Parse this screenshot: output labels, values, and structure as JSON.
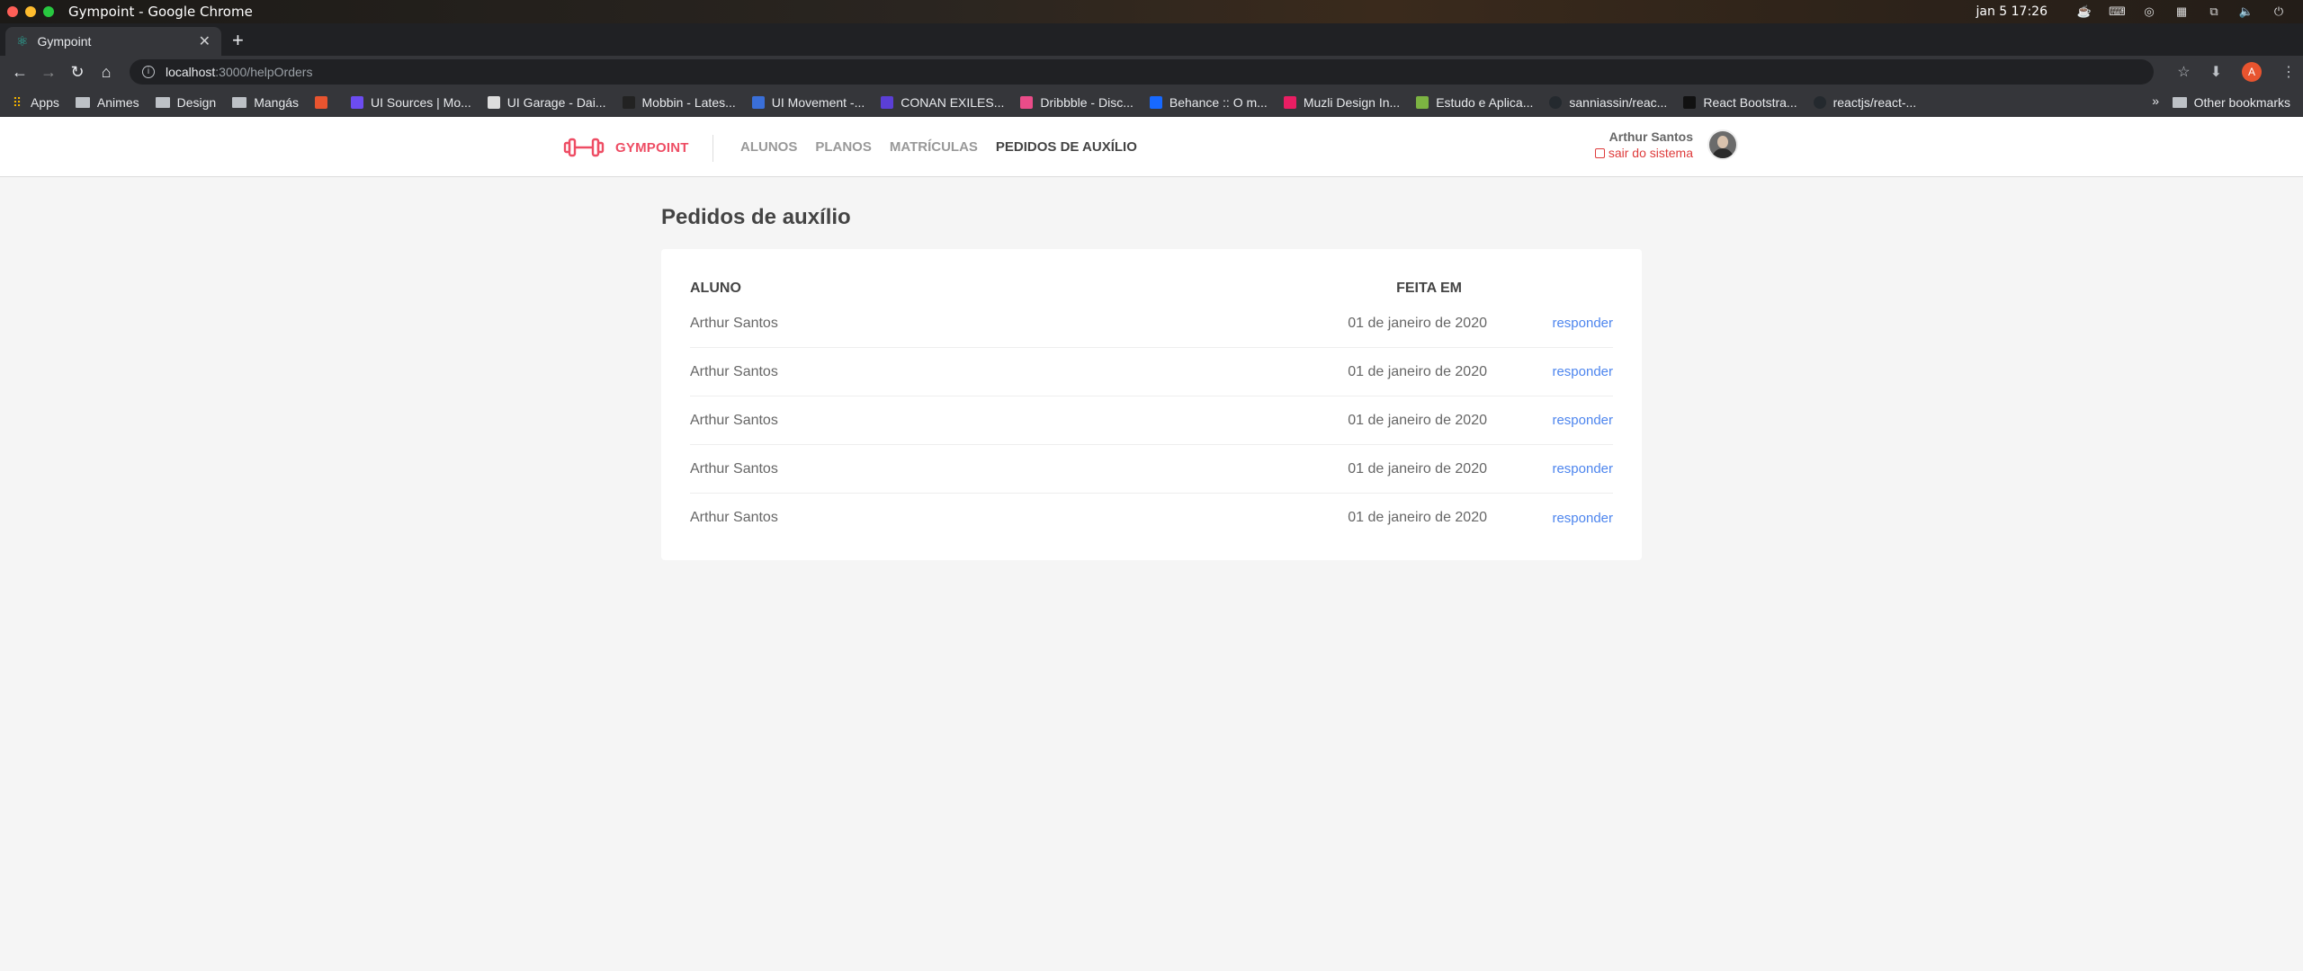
{
  "os": {
    "window_title": "Gympoint - Google Chrome",
    "clock": "jan 5  17:26"
  },
  "browser": {
    "tab_title": "Gympoint",
    "url_host": "localhost",
    "url_path": ":3000/helpOrders",
    "profile_initial": "A",
    "bookmarks": [
      {
        "label": "Apps",
        "icon": "apps-grid-icon",
        "color": "#f4b400"
      },
      {
        "label": "Animes",
        "icon": "folder-icon",
        "color": "#bdc1c6"
      },
      {
        "label": "Design",
        "icon": "folder-icon",
        "color": "#bdc1c6"
      },
      {
        "label": "Mangás",
        "icon": "folder-icon",
        "color": "#bdc1c6"
      },
      {
        "label": "",
        "icon": "site-icon",
        "color": "#e8542f"
      },
      {
        "label": "UI Sources | Mo...",
        "icon": "site-icon",
        "color": "#6c4cf1"
      },
      {
        "label": "UI Garage - Dai...",
        "icon": "site-icon",
        "color": "#dddddd"
      },
      {
        "label": "Mobbin - Lates...",
        "icon": "site-icon",
        "color": "#222222"
      },
      {
        "label": "UI Movement -...",
        "icon": "site-icon",
        "color": "#3a6fd8"
      },
      {
        "label": "CONAN EXILES...",
        "icon": "site-icon",
        "color": "#5b3fd6"
      },
      {
        "label": "Dribbble - Disc...",
        "icon": "site-icon",
        "color": "#ea4c89"
      },
      {
        "label": "Behance :: O m...",
        "icon": "site-icon",
        "color": "#1769ff"
      },
      {
        "label": "Muzli Design In...",
        "icon": "site-icon",
        "color": "#e91e63"
      },
      {
        "label": "Estudo e Aplica...",
        "icon": "site-icon",
        "color": "#7cb342"
      },
      {
        "label": "sanniassin/reac...",
        "icon": "github-icon",
        "color": "#24292e"
      },
      {
        "label": "React Bootstra...",
        "icon": "site-icon",
        "color": "#111111"
      },
      {
        "label": "reactjs/react-...",
        "icon": "github-icon",
        "color": "#24292e"
      }
    ],
    "more": "»",
    "other_bookmarks": "Other bookmarks"
  },
  "app": {
    "brand": "GYMPOINT",
    "brand_color": "#ee4d64",
    "nav": [
      {
        "label": "ALUNOS",
        "active": false
      },
      {
        "label": "PLANOS",
        "active": false
      },
      {
        "label": "MATRÍCULAS",
        "active": false
      },
      {
        "label": "PEDIDOS DE AUXÍLIO",
        "active": true
      }
    ],
    "user_name": "Arthur Santos",
    "logout_label": "sair do sistema"
  },
  "main": {
    "title": "Pedidos de auxílio",
    "columns": {
      "student": "ALUNO",
      "date": "FEITA EM"
    },
    "rows": [
      {
        "student": "Arthur Santos",
        "date": "01 de janeiro de 2020",
        "action": "responder"
      },
      {
        "student": "Arthur Santos",
        "date": "01 de janeiro de 2020",
        "action": "responder"
      },
      {
        "student": "Arthur Santos",
        "date": "01 de janeiro de 2020",
        "action": "responder"
      },
      {
        "student": "Arthur Santos",
        "date": "01 de janeiro de 2020",
        "action": "responder"
      },
      {
        "student": "Arthur Santos",
        "date": "01 de janeiro de 2020",
        "action": "responder"
      }
    ]
  }
}
